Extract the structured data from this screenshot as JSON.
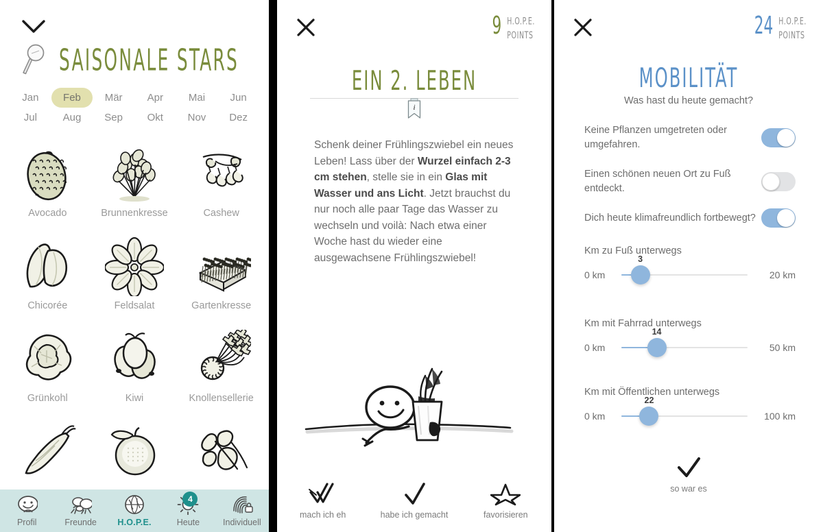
{
  "left_panel": {
    "collapse_icon": "chevron-down-icon",
    "search_icon": "magnifier-icon",
    "title": "SAISONALE STARS",
    "title_color": "#7a8c3c",
    "months": [
      {
        "label": "Jan",
        "active": false
      },
      {
        "label": "Feb",
        "active": true
      },
      {
        "label": "Mär",
        "active": false
      },
      {
        "label": "Apr",
        "active": false
      },
      {
        "label": "Mai",
        "active": false
      },
      {
        "label": "Jun",
        "active": false
      },
      {
        "label": "Jul",
        "active": false
      },
      {
        "label": "Aug",
        "active": false
      },
      {
        "label": "Sep",
        "active": false
      },
      {
        "label": "Okt",
        "active": false
      },
      {
        "label": "Nov",
        "active": false
      },
      {
        "label": "Dez",
        "active": false
      }
    ],
    "active_month_pill_color": "#e2e0ae",
    "items": [
      {
        "label": "Avocado",
        "icon": "avocado-icon"
      },
      {
        "label": "Brunnenkresse",
        "icon": "watercress-icon"
      },
      {
        "label": "Cashew",
        "icon": "cashew-icon"
      },
      {
        "label": "Chicorée",
        "icon": "chicory-icon"
      },
      {
        "label": "Feldsalat",
        "icon": "lambs-lettuce-icon"
      },
      {
        "label": "Gartenkresse",
        "icon": "garden-cress-icon"
      },
      {
        "label": "Grünkohl",
        "icon": "kale-icon"
      },
      {
        "label": "Kiwi",
        "icon": "kiwi-icon"
      },
      {
        "label": "Knollensellerie",
        "icon": "celeriac-icon"
      },
      {
        "label": "",
        "icon": "horseradish-icon"
      },
      {
        "label": "",
        "icon": "citrus-icon"
      },
      {
        "label": "",
        "icon": "parsnip-icon"
      }
    ],
    "bottom_nav": {
      "background": "#cfe5e4",
      "active_color": "#1f908c",
      "items": [
        {
          "label": "Profil",
          "icon": "face-icon",
          "active": false,
          "badge": ""
        },
        {
          "label": "Freunde",
          "icon": "friends-icon",
          "active": false,
          "badge": ""
        },
        {
          "label": "H.O.P.E.",
          "icon": "globe-icon",
          "active": true,
          "badge": ""
        },
        {
          "label": "Heute",
          "icon": "sun-icon",
          "active": false,
          "badge": "4"
        },
        {
          "label": "Individuell",
          "icon": "fingerprint-icon",
          "active": false,
          "badge": ""
        }
      ]
    }
  },
  "mid_panel": {
    "close_icon": "close-icon",
    "points_value": "9",
    "points_label_line1": "H.O.P.E.",
    "points_label_line2": "POINTS",
    "points_color": "#7a8c3c",
    "title": "EIN 2. LEBEN",
    "title_color": "#7a8c3c",
    "info_icon": "bookmark-info-icon",
    "body": {
      "part1": "Schenk deiner Frühlingszwiebel ein neues Leben! Lass über der ",
      "bold1": "Wurzel einfach 2-3 cm stehen",
      "part2": ", stelle sie in ein ",
      "bold2": "Glas mit Wasser und ans Licht",
      "part3": ". Jetzt brauchst du nur noch alle paar Tage das Wasser zu wechseln und voilà: Nach etwa einer Woche hast du wieder eine ausgewachsene Frühlingszwiebel!"
    },
    "illustration": "stickman-with-glass-illustration",
    "actions": [
      {
        "label": "mach ich eh",
        "icon": "double-check-icon"
      },
      {
        "label": "habe ich gemacht",
        "icon": "check-icon"
      },
      {
        "label": "favorisieren",
        "icon": "star-icon"
      }
    ]
  },
  "right_panel": {
    "close_icon": "close-icon",
    "points_value": "24",
    "points_label_line1": "H.O.P.E.",
    "points_label_line2": "POINTS",
    "points_color": "#5b91c8",
    "title": "MOBILITÄT",
    "title_color": "#5b91c8",
    "subtitle": "Was hast du heute gemacht?",
    "toggles": [
      {
        "label": "Keine Pflanzen umgetreten oder umgefahren.",
        "state": "on"
      },
      {
        "label": "Einen schönen neuen Ort zu Fuß entdeckt.",
        "state": "off"
      },
      {
        "label": "Dich heute klimafreundlich fortbewegt?",
        "state": "on"
      }
    ],
    "toggle_on_color": "#8fb6dd",
    "toggle_off_color": "#e2e3e5",
    "sliders": [
      {
        "title": "Km zu Fuß unterwegs",
        "min_label": "0 km",
        "max_label": "20 km",
        "value": "3",
        "min": 0,
        "max": 20
      },
      {
        "title": "Km mit Fahrrad unterwegs",
        "min_label": "0 km",
        "max_label": "50 km",
        "value": "14",
        "min": 0,
        "max": 50
      },
      {
        "title": "Km mit Öffentlichen unterwegs",
        "min_label": "0 km",
        "max_label": "100 km",
        "value": "22",
        "min": 0,
        "max": 100
      }
    ],
    "confirm": {
      "label": "so war es",
      "icon": "check-icon"
    }
  }
}
